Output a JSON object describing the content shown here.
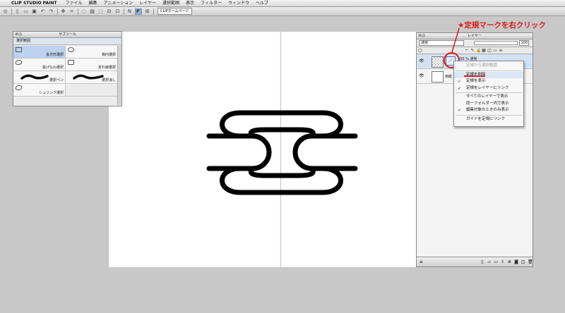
{
  "menubar": {
    "apple_glyph": "",
    "app_name": "CLIP STUDIO PAINT",
    "items": [
      "ファイル",
      "編集",
      "アニメーション",
      "レイヤー",
      "選択範囲",
      "表示",
      "フィルター",
      "ウィンドウ",
      "ヘルプ"
    ]
  },
  "toolbar": {
    "tab_label": "CLIPホームページ"
  },
  "subtool_palette": {
    "title": "サブツール",
    "group": "選択範囲",
    "tools": [
      {
        "label": "長方形選択"
      },
      {
        "label": "楕円選択"
      },
      {
        "label": "投げなわ選択"
      },
      {
        "label": "折れ線選択"
      },
      {
        "label": "選択ペン"
      },
      {
        "label": "選択消し"
      },
      {
        "label": "シュリンク選択"
      }
    ]
  },
  "layer_palette": {
    "title": "レイヤー",
    "blend_mode": "通常",
    "opacity": "100",
    "layer1_label": "100 % 通常",
    "layer2_label": "用紙"
  },
  "context_menu": {
    "items": [
      {
        "label": "定規から選択範囲",
        "enabled": false,
        "checked": false
      },
      {
        "label": "定規を削除",
        "enabled": true,
        "checked": false
      },
      {
        "label": "定規を表示",
        "enabled": true,
        "checked": true
      },
      {
        "label": "定規をレイヤーにリンク",
        "enabled": true,
        "checked": true
      },
      {
        "label": "すべてのレイヤーで表示",
        "enabled": true,
        "checked": false
      },
      {
        "label": "同一フォルダー内で表示",
        "enabled": true,
        "checked": false
      },
      {
        "label": "編集対象のときのみ表示",
        "enabled": true,
        "checked": true
      },
      {
        "label": "ガイドを定規にリンク",
        "enabled": true,
        "checked": false
      }
    ]
  },
  "annotation": {
    "text": "★定規マークを右クリック",
    "color": "#e01818"
  }
}
